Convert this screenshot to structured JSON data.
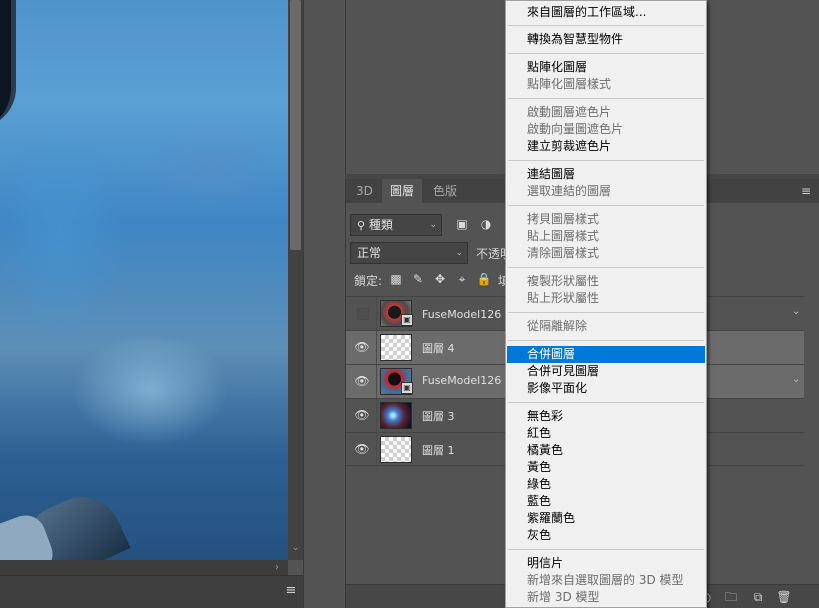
{
  "layers_panel": {
    "tabs": [
      {
        "label": "3D",
        "active": false
      },
      {
        "label": "圖層",
        "active": true
      },
      {
        "label": "色版",
        "active": false
      }
    ],
    "filter": {
      "value": "種類",
      "icon": "search-icon"
    },
    "blend_mode": {
      "value": "正常"
    },
    "opacity_label": "不透明",
    "lock_label": "鎖定:",
    "layers": [
      {
        "name": "FuseModel126 拷",
        "visible": false,
        "selected": false,
        "thumb": "fuse",
        "smart_object": true
      },
      {
        "name": "圖層 4",
        "visible": true,
        "selected": true,
        "thumb": "transparent",
        "smart_object": false
      },
      {
        "name": "FuseModel126",
        "visible": true,
        "selected": true,
        "thumb": "fuse2",
        "smart_object": true
      },
      {
        "name": "圖層 3",
        "visible": true,
        "selected": false,
        "thumb": "space",
        "smart_object": false
      },
      {
        "name": "圖層 1",
        "visible": true,
        "selected": false,
        "thumb": "transparent",
        "smart_object": false
      }
    ]
  },
  "context_menu": {
    "items": [
      {
        "label": "來自圖層的工作區域...",
        "disabled": false
      },
      {
        "label": "轉換為智慧型物件",
        "disabled": false
      },
      {
        "label": "點陣化圖層",
        "disabled": false
      },
      {
        "label": "點陣化圖層樣式",
        "disabled": true
      },
      {
        "label": "啟動圖層遮色片",
        "disabled": true
      },
      {
        "label": "啟動向量圖遮色片",
        "disabled": true
      },
      {
        "label": "建立剪裁遮色片",
        "disabled": false
      },
      {
        "label": "連結圖層",
        "disabled": false
      },
      {
        "label": "選取連結的圖層",
        "disabled": true
      },
      {
        "label": "拷貝圖層樣式",
        "disabled": true
      },
      {
        "label": "貼上圖層樣式",
        "disabled": true
      },
      {
        "label": "清除圖層樣式",
        "disabled": true
      },
      {
        "label": "複製形狀屬性",
        "disabled": true
      },
      {
        "label": "貼上形狀屬性",
        "disabled": true
      },
      {
        "label": "從隔離解除",
        "disabled": true
      },
      {
        "label": "合併圖層",
        "disabled": false,
        "highlighted": true
      },
      {
        "label": "合併可見圖層",
        "disabled": false
      },
      {
        "label": "影像平面化",
        "disabled": false
      },
      {
        "label": "無色彩",
        "disabled": false
      },
      {
        "label": "紅色",
        "disabled": false
      },
      {
        "label": "橘黃色",
        "disabled": false
      },
      {
        "label": "黃色",
        "disabled": false
      },
      {
        "label": "綠色",
        "disabled": false
      },
      {
        "label": "藍色",
        "disabled": false
      },
      {
        "label": "紫羅蘭色",
        "disabled": false
      },
      {
        "label": "灰色",
        "disabled": false
      },
      {
        "label": "明信片",
        "disabled": false
      },
      {
        "label": "新增來自選取圖層的 3D 模型",
        "disabled": true
      },
      {
        "label": "新增 3D 模型",
        "disabled": true
      }
    ]
  },
  "colors": {
    "panel_bg": "#535353",
    "menu_bg": "#f0f0f0",
    "menu_highlight": "#0078d7",
    "selected_layer": "#6b6b6b"
  }
}
